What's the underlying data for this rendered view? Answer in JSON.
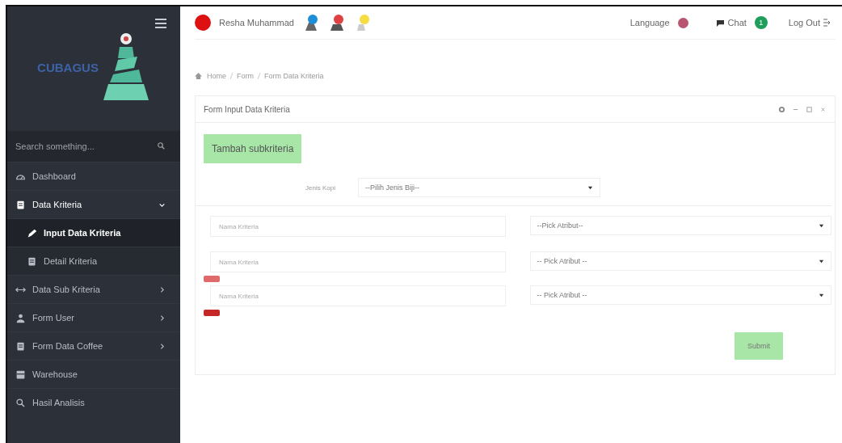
{
  "sidebar": {
    "logo_text": "CUBAGUS",
    "search": {
      "placeholder": "Search something..."
    },
    "items": [
      {
        "label": "Dashboard",
        "selected": false
      },
      {
        "label": "Data Kriteria",
        "selected": false,
        "expanded": true,
        "children": [
          {
            "label": "Input Data Kriteria",
            "selected": true
          },
          {
            "label": "Detail Kriteria",
            "selected": false
          }
        ]
      },
      {
        "label": "Data Sub Kriteria",
        "selected": false,
        "expanded": false
      },
      {
        "label": "Form User",
        "selected": false,
        "expanded": false
      },
      {
        "label": "Form Data Coffee",
        "selected": false,
        "expanded": false
      },
      {
        "label": "Warehouse",
        "selected": false
      },
      {
        "label": "Hasil Analisis",
        "selected": false
      }
    ]
  },
  "header": {
    "user": "Resha Muhammad",
    "language": "Language",
    "chat": "Chat",
    "chat_badge": "1",
    "logout": "Log Out"
  },
  "breadcrumb": [
    "Home",
    "Form",
    "Form Data Kriteria"
  ],
  "panel": {
    "title": "Form Input Data Kriteria",
    "add_button": "Tambah subkriteria",
    "type_label": "Jenis Kopi",
    "type_select": "--Pilih Jenis Biji--",
    "rows": [
      {
        "placeholder": "Nama Kriteria",
        "select": "--Pick Atribut--"
      },
      {
        "placeholder": "Nama Kriteria",
        "select": "-- Pick Atribut --",
        "color": "#e06a6a"
      },
      {
        "placeholder": "Nama Kriteria",
        "select": "-- Pick Atribut --",
        "color": "#c62828"
      }
    ],
    "submit": "Submit"
  }
}
